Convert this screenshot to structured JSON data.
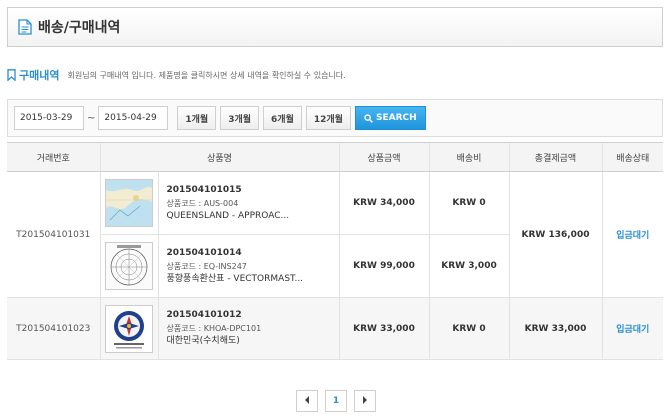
{
  "page": {
    "title": "배송/구매내역"
  },
  "section": {
    "title": "구매내역",
    "description": "회원님의 구매내역 입니다. 제품명을 클릭하시면 상세 내역을 확인하실 수 있습니다."
  },
  "filter": {
    "start_date": "2015-03-29",
    "separator": "~",
    "end_date": "2015-04-29",
    "periods": [
      "1개월",
      "3개월",
      "6개월",
      "12개월"
    ],
    "search_label": "SEARCH"
  },
  "table": {
    "headers": [
      "거래번호",
      "상품명",
      "상품금액",
      "배송비",
      "총결제금액",
      "배송상태"
    ],
    "orders": [
      {
        "transaction_id": "T201504101031",
        "total": "KRW 136,000",
        "status": "입금대기",
        "items": [
          {
            "product_id": "201504101015",
            "code": "상품코드 : AUS-004",
            "name": "QUEENSLAND - APPROAC...",
            "price": "KRW 34,000",
            "shipping": "KRW 0",
            "thumb": "nautical-chart"
          },
          {
            "product_id": "201504101014",
            "code": "상품코드 : EQ-INS247",
            "name": "풍향풍속환산표 - VECTORMAST...",
            "price": "KRW 99,000",
            "shipping": "KRW 3,000",
            "thumb": "compass-rose"
          }
        ]
      },
      {
        "transaction_id": "T201504101023",
        "total": "KRW 33,000",
        "status": "입금대기",
        "items": [
          {
            "product_id": "201504101012",
            "code": "상품코드 : KHOA-DPC101",
            "name": "대한민국(수치해도)",
            "price": "KRW 33,000",
            "shipping": "KRW 0",
            "thumb": "hydrographic-seal"
          }
        ]
      }
    ]
  },
  "pagination": {
    "current": "1"
  },
  "colors": {
    "accent": "#2a8fd1",
    "search_button": "#1e95dc",
    "status": "#2a8fd1"
  }
}
